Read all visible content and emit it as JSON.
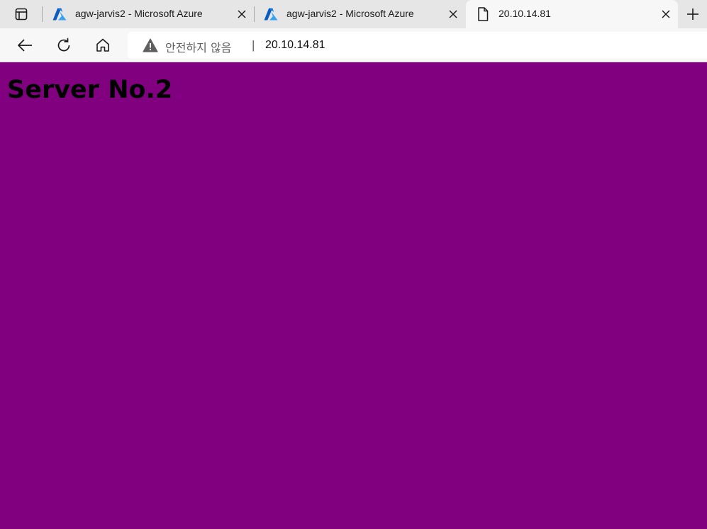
{
  "browser": {
    "tabs": [
      {
        "title": "agw-jarvis2 - Microsoft Azure",
        "favicon": "azure-icon",
        "active": false
      },
      {
        "title": "agw-jarvis2 - Microsoft Azure",
        "favicon": "azure-icon",
        "active": false
      },
      {
        "title": "20.10.14.81",
        "favicon": "page-icon",
        "active": true
      }
    ],
    "address_bar": {
      "security_label": "안전하지 않음",
      "separator": "|",
      "url": "20.10.14.81"
    }
  },
  "page": {
    "heading": "Server No.2"
  },
  "colors": {
    "page_background": "#800080",
    "heading_text": "#000000",
    "azure_blue": "#0078d4"
  }
}
